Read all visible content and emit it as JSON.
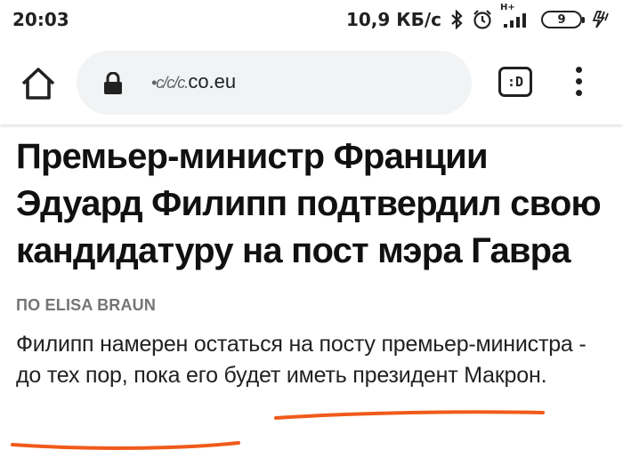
{
  "status_bar": {
    "time": "20:03",
    "net_speed": "10,9 КБ/с",
    "network_type": "H+",
    "battery_level": "9",
    "icons": [
      "bluetooth-icon",
      "alarm-icon",
      "signal-icon",
      "battery-icon",
      "charging-icon"
    ]
  },
  "browser": {
    "url_prefix": "•c/c/c.",
    "url_domain": "co.eu",
    "tabs_label": ":D",
    "icons": [
      "home-icon",
      "lock-icon",
      "tabs-icon",
      "menu-icon"
    ]
  },
  "article": {
    "headline": "Премьер-министр Франции Эдуард Филипп подтвердил свою кандидатуру на пост мэра Гавра",
    "byline": "ПО ELISA BRAUN",
    "lead": "Филипп намерен остаться на посту премьер-министра - до тех пор, пока его будет иметь президент Макрон."
  },
  "colors": {
    "annotation": "#f05a1a",
    "url_bar_bg": "#f1f3f4",
    "byline": "#757575"
  }
}
